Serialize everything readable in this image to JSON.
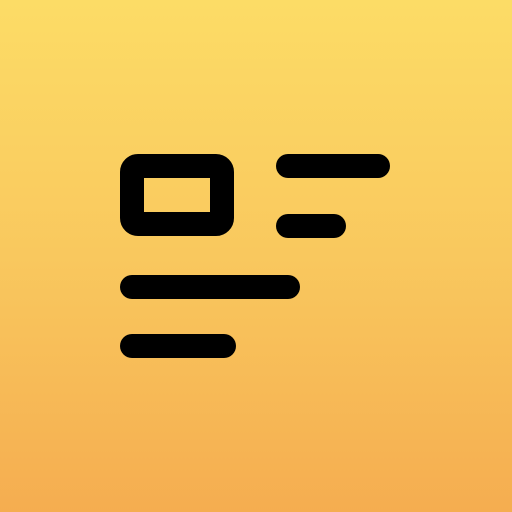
{
  "icon": {
    "name": "article-layout-icon",
    "background_top_color": "#fcdc66",
    "background_bottom_color": "#f5ad50",
    "stroke_color": "#000000"
  }
}
